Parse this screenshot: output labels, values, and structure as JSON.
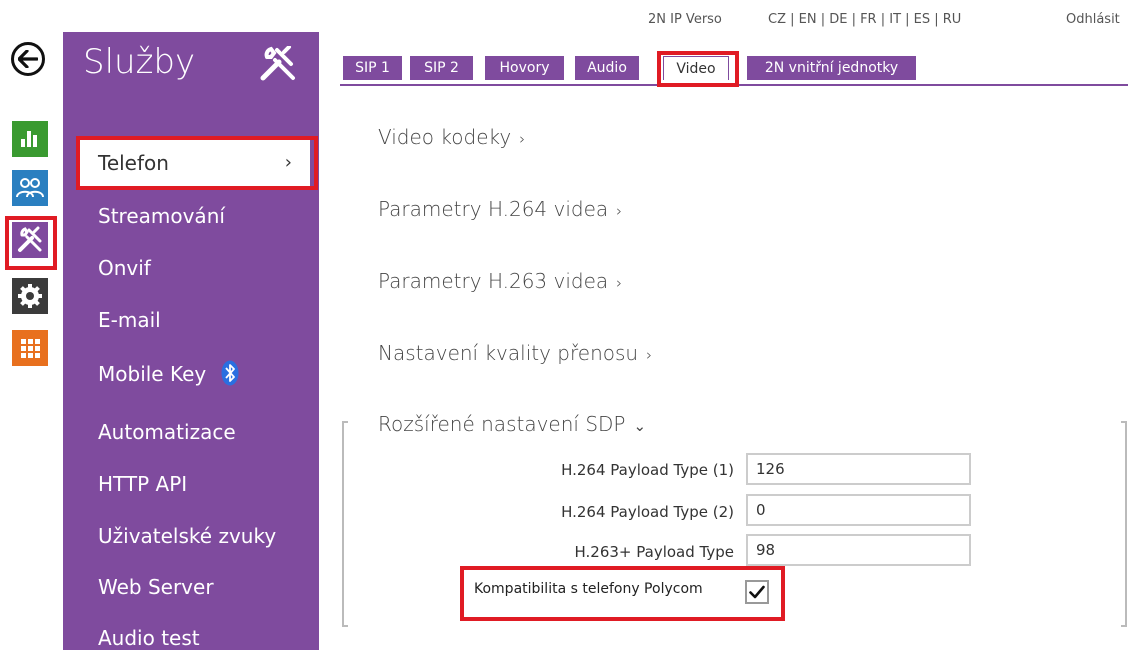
{
  "header": {
    "device_name": "2N IP Verso",
    "languages": "CZ | EN | DE | FR | IT | ES | RU",
    "logout": "Odhlásit"
  },
  "rail": {
    "icons": [
      "back-arrow-icon",
      "statistics-icon",
      "users-icon",
      "services-icon",
      "settings-gear-icon",
      "grid-apps-icon"
    ],
    "colors": {
      "stats": "#3a9a30",
      "users": "#2a7fc0",
      "services": "#7f4a9e",
      "settings": "#3b3b3b",
      "apps": "#e8701e"
    }
  },
  "sidebar": {
    "title": "Služby",
    "items": [
      {
        "label": "Telefon",
        "active": true
      },
      {
        "label": "Streamování"
      },
      {
        "label": "Onvif"
      },
      {
        "label": "E-mail"
      },
      {
        "label": "Mobile Key"
      },
      {
        "label": "Automatizace"
      },
      {
        "label": "HTTP API"
      },
      {
        "label": "Uživatelské zvuky"
      },
      {
        "label": "Web Server"
      },
      {
        "label": "Audio test"
      }
    ],
    "chevron": "›",
    "background": "#7f4b9e"
  },
  "tabs": [
    {
      "label": "SIP 1"
    },
    {
      "label": "SIP 2"
    },
    {
      "label": "Hovory"
    },
    {
      "label": "Audio"
    },
    {
      "label": "Video",
      "active": true
    },
    {
      "label": "2N vnitřní jednotky"
    }
  ],
  "sections": [
    {
      "label": "Video kodeky",
      "chevron": "›"
    },
    {
      "label": "Parametry H.264 videa",
      "chevron": "›"
    },
    {
      "label": "Parametry H.263 videa",
      "chevron": "›"
    },
    {
      "label": "Nastavení kvality přenosu",
      "chevron": "›"
    },
    {
      "label": "Rozšířené nastavení SDP",
      "chevron": "⌄"
    }
  ],
  "sdp": {
    "fields": [
      {
        "label": "H.264 Payload Type (1)",
        "value": "126"
      },
      {
        "label": "H.264 Payload Type (2)",
        "value": "0"
      },
      {
        "label": "H.263+ Payload Type",
        "value": "98"
      }
    ],
    "polycom": {
      "label": "Kompatibilita s telefony Polycom",
      "checked": true
    }
  },
  "highlight_color": "#e01b24"
}
